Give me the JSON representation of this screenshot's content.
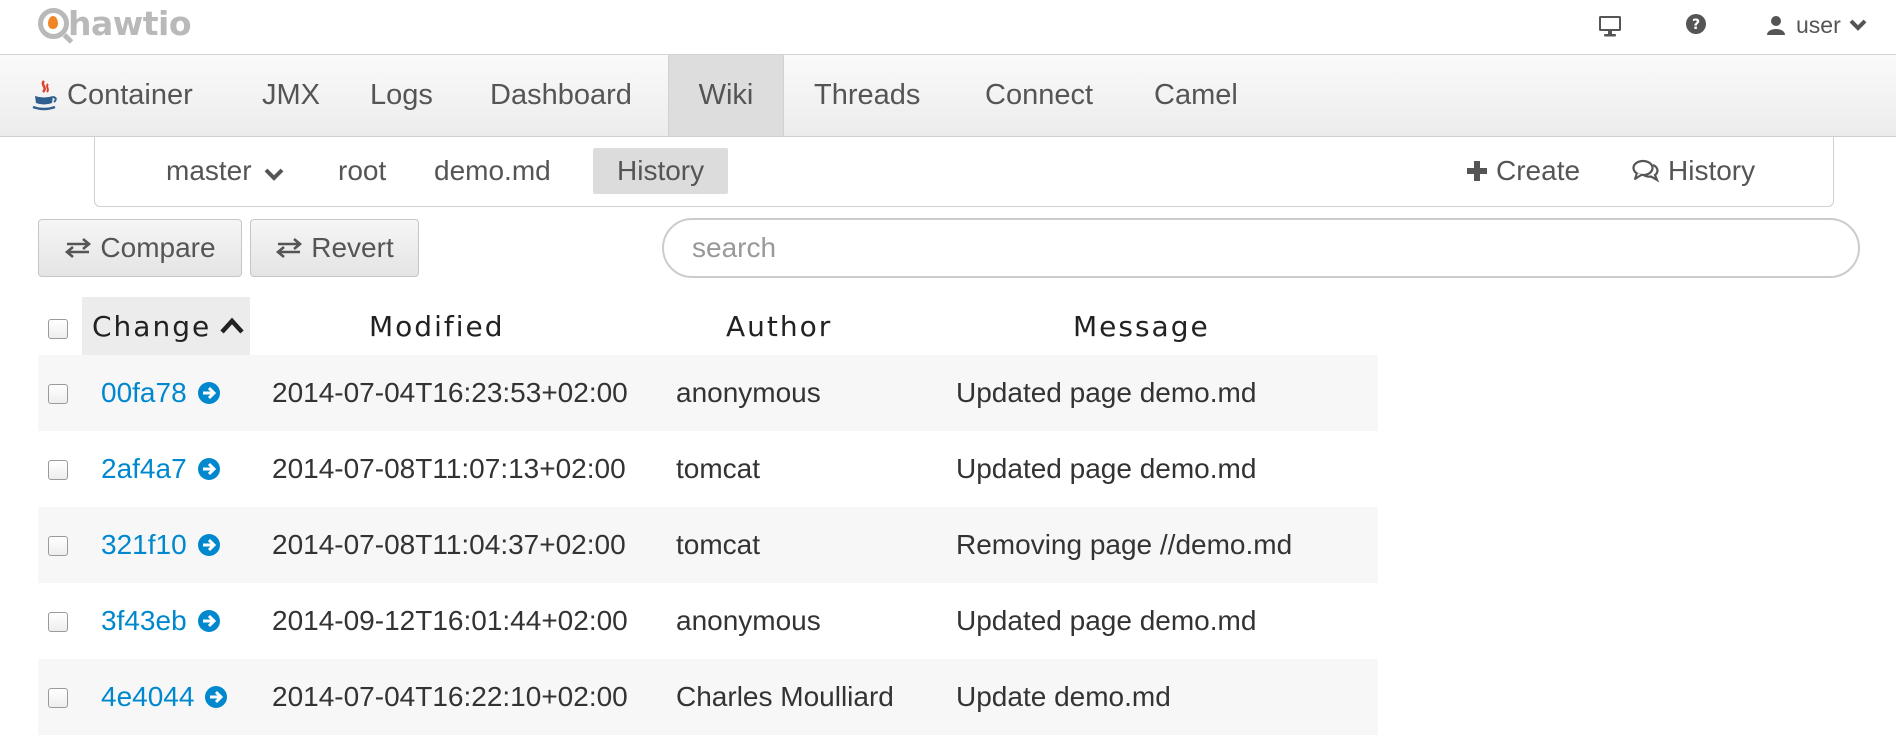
{
  "topbar": {
    "logo_text": "hawtio",
    "user_label": "user",
    "icons": [
      "monitor-icon",
      "help-icon",
      "user-icon",
      "chevron-down-icon"
    ]
  },
  "nav": {
    "items": [
      {
        "label": "Container",
        "icon": "java-icon"
      },
      {
        "label": "JMX"
      },
      {
        "label": "Logs"
      },
      {
        "label": "Dashboard"
      },
      {
        "label": "Wiki",
        "active": true
      },
      {
        "label": "Threads"
      },
      {
        "label": "Connect"
      },
      {
        "label": "Camel"
      }
    ]
  },
  "subnav": {
    "branch": "master",
    "breadcrumbs": [
      "root",
      "demo.md"
    ],
    "active_tab": "History",
    "create_label": "Create",
    "history_label": "History"
  },
  "toolbar": {
    "compare_label": "Compare",
    "revert_label": "Revert",
    "search_placeholder": "search"
  },
  "table": {
    "columns": [
      "Change",
      "Modified",
      "Author",
      "Message"
    ],
    "sorted_column": "Change",
    "sort_direction": "ascending",
    "rows": [
      {
        "change": "00fa78",
        "modified": "2014-07-04T16:23:53+02:00",
        "author": "anonymous",
        "message": "Updated page demo.md"
      },
      {
        "change": "2af4a7",
        "modified": "2014-07-08T11:07:13+02:00",
        "author": "tomcat",
        "message": "Updated page demo.md"
      },
      {
        "change": "321f10",
        "modified": "2014-07-08T11:04:37+02:00",
        "author": "tomcat",
        "message": "Removing page //demo.md"
      },
      {
        "change": "3f43eb",
        "modified": "2014-09-12T16:01:44+02:00",
        "author": "anonymous",
        "message": "Updated page demo.md"
      },
      {
        "change": "4e4044",
        "modified": "2014-07-04T16:22:10+02:00",
        "author": "Charles Moulliard",
        "message": "Update demo.md"
      }
    ]
  },
  "colors": {
    "link": "#0088ce",
    "logo_gray": "#b9b9b9",
    "logo_flame": "#f08526",
    "nav_active_bg": "#dddddd",
    "row_stripe": "#f7f7f7"
  }
}
